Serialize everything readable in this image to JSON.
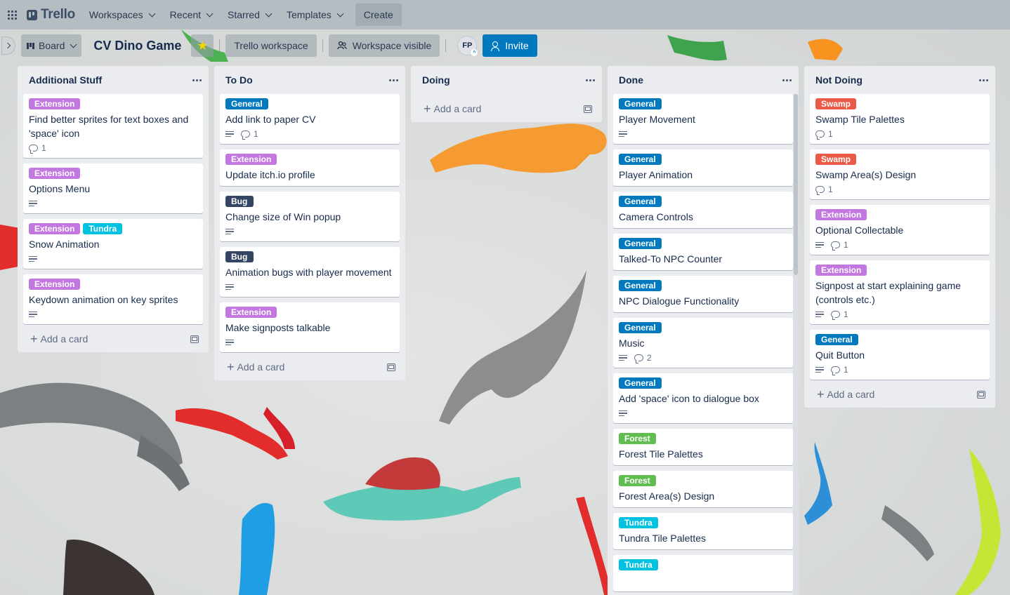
{
  "topnav": {
    "logo": "Trello",
    "menus": [
      "Workspaces",
      "Recent",
      "Starred",
      "Templates"
    ],
    "create": "Create"
  },
  "board": {
    "view": "Board",
    "title": "CV Dino Game",
    "starred": true,
    "workspace": "Trello workspace",
    "visibility": "Workspace visible",
    "member_initials": "FP",
    "invite": "Invite"
  },
  "colors": {
    "accent": "#0079bf",
    "Extension": "#c377e0",
    "General": "#0079bf",
    "Bug": "#344563",
    "Tundra": "#00c2e0",
    "Swamp": "#eb5a46",
    "Forest": "#61bd4f"
  },
  "add_card": "Add a card",
  "lists": [
    {
      "title": "Additional Stuff",
      "cards": [
        {
          "labels": [
            "Extension"
          ],
          "title": "Find better sprites for text boxes and 'space' icon",
          "description": false,
          "comments": "1"
        },
        {
          "labels": [
            "Extension"
          ],
          "title": "Options Menu",
          "description": true,
          "comments": ""
        },
        {
          "labels": [
            "Extension",
            "Tundra"
          ],
          "title": "Snow Animation",
          "description": true,
          "comments": ""
        },
        {
          "labels": [
            "Extension"
          ],
          "title": "Keydown animation on key sprites",
          "description": true,
          "comments": ""
        }
      ]
    },
    {
      "title": "To Do",
      "cards": [
        {
          "labels": [
            "General"
          ],
          "title": "Add link to paper CV",
          "description": true,
          "comments": "1"
        },
        {
          "labels": [
            "Extension"
          ],
          "title": "Update itch.io profile",
          "description": false,
          "comments": ""
        },
        {
          "labels": [
            "Bug"
          ],
          "title": "Change size of Win popup",
          "description": true,
          "comments": ""
        },
        {
          "labels": [
            "Bug"
          ],
          "title": "Animation bugs with player movement",
          "description": true,
          "comments": ""
        },
        {
          "labels": [
            "Extension"
          ],
          "title": "Make signposts talkable",
          "description": true,
          "comments": ""
        }
      ]
    },
    {
      "title": "Doing",
      "cards": []
    },
    {
      "title": "Done",
      "cards": [
        {
          "labels": [
            "General"
          ],
          "title": "Player Movement",
          "description": true,
          "comments": ""
        },
        {
          "labels": [
            "General"
          ],
          "title": "Player Animation",
          "description": false,
          "comments": ""
        },
        {
          "labels": [
            "General"
          ],
          "title": "Camera Controls",
          "description": false,
          "comments": ""
        },
        {
          "labels": [
            "General"
          ],
          "title": "Talked-To NPC Counter",
          "description": false,
          "comments": ""
        },
        {
          "labels": [
            "General"
          ],
          "title": "NPC Dialogue Functionality",
          "description": false,
          "comments": ""
        },
        {
          "labels": [
            "General"
          ],
          "title": "Music",
          "description": true,
          "comments": "2"
        },
        {
          "labels": [
            "General"
          ],
          "title": "Add 'space' icon to dialogue box",
          "description": true,
          "comments": ""
        },
        {
          "labels": [
            "Forest"
          ],
          "title": "Forest Tile Palettes",
          "description": false,
          "comments": ""
        },
        {
          "labels": [
            "Forest"
          ],
          "title": "Forest Area(s) Design",
          "description": false,
          "comments": ""
        },
        {
          "labels": [
            "Tundra"
          ],
          "title": "Tundra Tile Palettes",
          "description": false,
          "comments": ""
        },
        {
          "labels": [
            "Tundra"
          ],
          "title": "",
          "description": false,
          "comments": ""
        }
      ]
    },
    {
      "title": "Not Doing",
      "cards": [
        {
          "labels": [
            "Swamp"
          ],
          "title": "Swamp Tile Palettes",
          "description": false,
          "comments": "1"
        },
        {
          "labels": [
            "Swamp"
          ],
          "title": "Swamp Area(s) Design",
          "description": false,
          "comments": "1"
        },
        {
          "labels": [
            "Extension"
          ],
          "title": "Optional Collectable",
          "description": true,
          "comments": "1"
        },
        {
          "labels": [
            "Extension"
          ],
          "title": "Signpost at start explaining game (controls etc.)",
          "description": true,
          "comments": "1"
        },
        {
          "labels": [
            "General"
          ],
          "title": "Quit Button",
          "description": true,
          "comments": "1"
        }
      ]
    }
  ]
}
